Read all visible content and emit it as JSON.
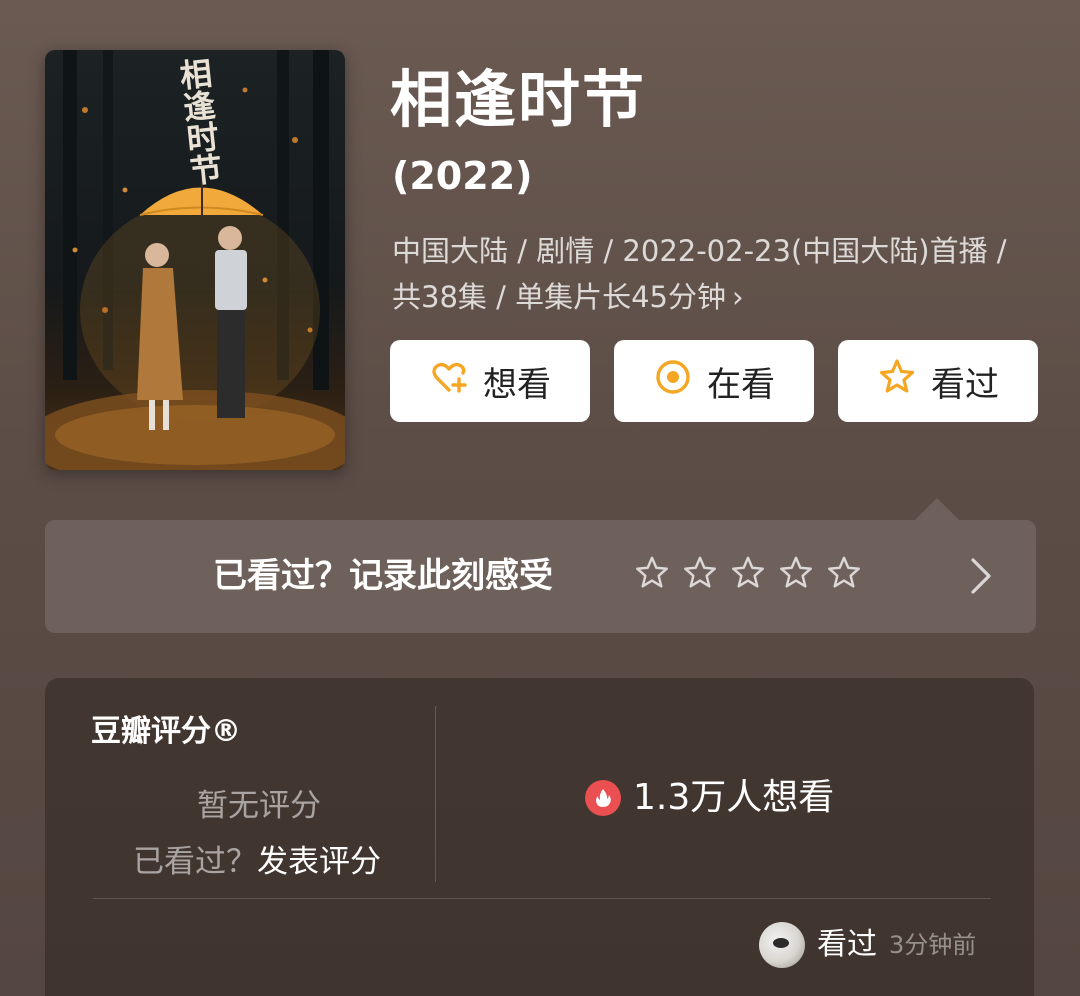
{
  "poster": {
    "title_art": "相逢时节"
  },
  "show": {
    "title": "相逢时节",
    "year": "(2022)",
    "meta": "中国大陆 / 剧情 / 2022-02-23(中国大陆)首播 / 共38集 / 单集片长45分钟",
    "meta_chevron": "›"
  },
  "actions": [
    {
      "label": "想看",
      "icon": "heart-plus-icon"
    },
    {
      "label": "在看",
      "icon": "target-circle-icon"
    },
    {
      "label": "看过",
      "icon": "star-outline-icon"
    }
  ],
  "prompt": {
    "text": "已看过？记录此刻感受",
    "stars": 5,
    "arrow_icon": "chevron-right-icon"
  },
  "rating": {
    "label": "豆瓣评分®",
    "no_score": "暂无评分",
    "seen_prefix": "已看过？",
    "seen_link": "发表评分",
    "want_count": "1.3万人想看",
    "want_icon": "fire-icon"
  },
  "activity": {
    "label": "看过",
    "time": "3分钟前",
    "avatar_icon": "avatar"
  },
  "colors": {
    "accent_orange": "#f5a623",
    "fire_red": "#ea4f52",
    "background": "#5c4d46"
  }
}
